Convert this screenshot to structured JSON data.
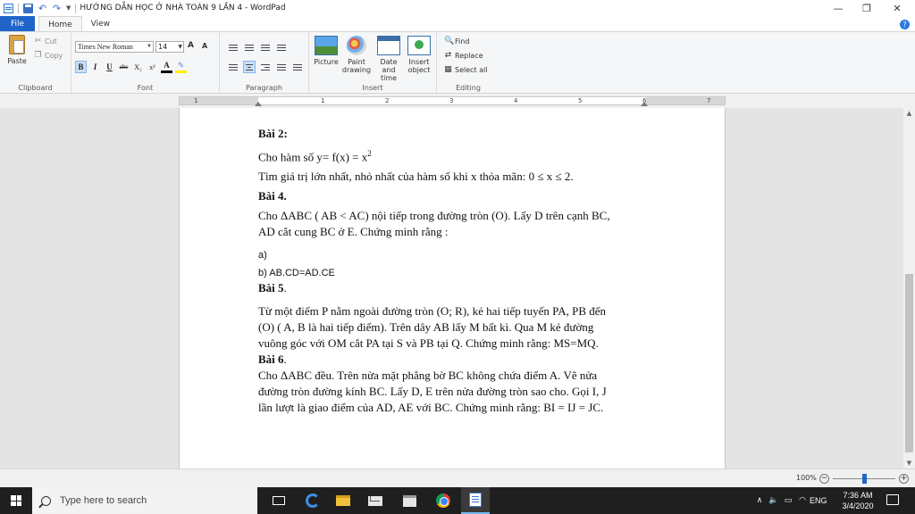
{
  "window": {
    "title": "HƯỚNG DẪN HỌC Ở NHÀ TOÁN 9 LẦN 4 - WordPad",
    "minimize_glyph": "—",
    "maximize_glyph": "❐",
    "close_glyph": "✕"
  },
  "tabs": {
    "file": "File",
    "home": "Home",
    "view": "View"
  },
  "ribbon": {
    "clipboard": {
      "paste": "Paste",
      "cut": "Cut",
      "copy": "Copy",
      "label": "Clipboard"
    },
    "font": {
      "name": "Times New Roman",
      "size": "14",
      "grow": "A",
      "shrink": "A",
      "bold": "B",
      "italic": "I",
      "underline": "U",
      "strikethrough": "abc",
      "subscript": "X₂",
      "superscript": "x²",
      "color": "A",
      "highlight": "✎",
      "label": "Font"
    },
    "paragraph": {
      "label": "Paragraph"
    },
    "insert": {
      "picture": "Picture",
      "paint": "Paint drawing",
      "datetime": "Date and time",
      "object": "Insert object",
      "label": "Insert"
    },
    "editing": {
      "find": "Find",
      "replace": "Replace",
      "select_all": "Select all",
      "label": "Editing"
    }
  },
  "ruler": {
    "numbers": [
      "1",
      "1",
      "2",
      "3",
      "4",
      "5",
      "6",
      "7"
    ]
  },
  "document": {
    "bai2_title": "Bài 2:",
    "bai2_line1": "Cho hàm số y= f(x) = x",
    "bai2_sup": "2",
    "bai2_line2": "Tìm giá trị lớn nhất, nhỏ nhất của hàm số khi x thỏa mãn:  0 ≤ x ≤ 2.",
    "bai4_title": "Bài 4.",
    "bai4_line1": "Cho ΔABC ( AB < AC) nội tiếp trong đường tròn (O). Lấy D trên cạnh BC,",
    "bai4_line2": "AD cắt cung BC ở E. Chứng minh rằng :",
    "bai4_a": "a)",
    "bai4_b": "b) AB.CD=AD.CE",
    "bai5_title": "Bài 5",
    "bai5_dot": ".",
    "bai5_line1": "Từ một điểm P nằm ngoài đường tròn (O; R), kẻ hai tiếp tuyến PA, PB đến",
    "bai5_line2": "(O)      ( A, B là hai tiếp điểm). Trên dây AB lấy M bất kì. Qua M kẻ đường",
    "bai5_line3": "vuông góc với OM cắt PA tại S và PB tại Q. Chứng minh rằng: MS=MQ.",
    "bai6_title": "Bài 6",
    "bai6_dot": ".",
    "bai6_line1": "Cho ΔABC đều. Trên nửa mặt phẳng bờ BC không chứa điểm A. Vẽ nửa",
    "bai6_line2": "đường tròn đường kính BC. Lấy D, E trên nửa đường tròn sao cho.  Gọi I, J",
    "bai6_line3": "lần lượt là giao điểm của AD, AE với BC. Chứng minh rằng: BI = IJ = JC."
  },
  "status": {
    "zoom": "100%",
    "minus": "−",
    "plus": "+"
  },
  "taskbar": {
    "search_placeholder": "Type here to search",
    "language": "ENG",
    "time": "7:36 AM",
    "date": "3/4/2020"
  }
}
